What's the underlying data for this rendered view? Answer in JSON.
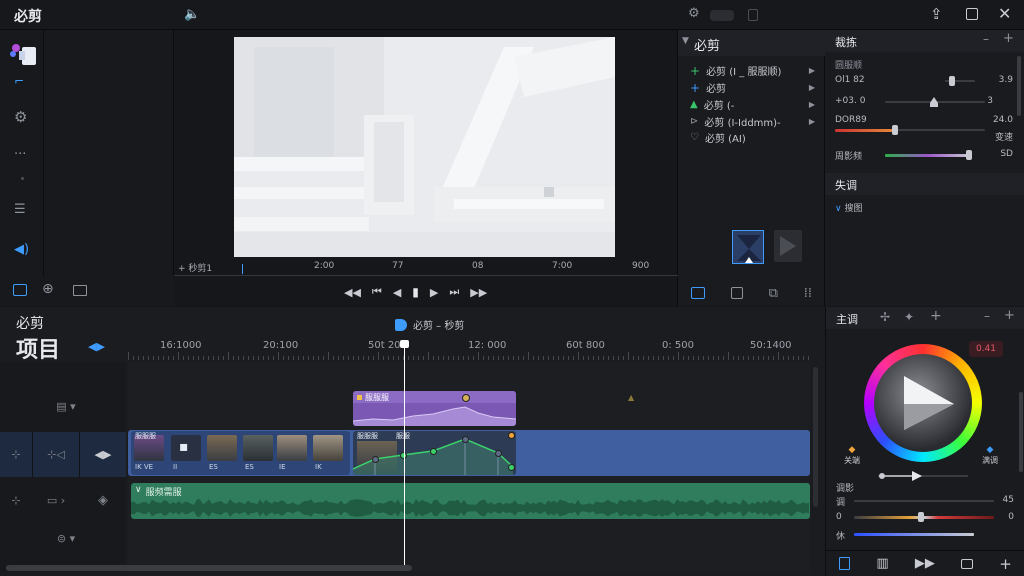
{
  "app": {
    "title": "必剪"
  },
  "titlebar": {
    "left_icon": "speaker-icon",
    "center_icons": [
      "settings-icon",
      "toggle-icon",
      "save-icon"
    ],
    "right_icons": [
      "upload-icon",
      "maximize-icon",
      "close-icon"
    ]
  },
  "left_toolbar": {
    "items": [
      "logo-icon",
      "crop-icon",
      "gear-icon",
      "more-icon",
      "list-icon",
      "volume-icon"
    ],
    "bottom": [
      "monitor-icon",
      "target-icon",
      "frame-icon"
    ]
  },
  "preview": {
    "timecodes": [
      "+ 秒剪1",
      "2:00",
      "77",
      "08",
      "7:00",
      "900"
    ],
    "controls": [
      "rewind-icon",
      "prev-icon",
      "step-back-icon",
      "play-pause-icon",
      "step-forward-icon",
      "next-icon",
      "fast-forward-icon"
    ]
  },
  "effects_panel": {
    "title": "必剪",
    "items": [
      {
        "label": "必剪 (I _ 服服顺)",
        "icon": "plus-icon"
      },
      {
        "label": "必剪",
        "icon": "plus-icon"
      },
      {
        "label": "必剪 (-",
        "icon": "triangle-icon"
      },
      {
        "label": "必剪 (I-Iddmm)-",
        "icon": "play-icon"
      },
      {
        "label": "必剪 (AI)",
        "icon": "heart-icon"
      }
    ]
  },
  "properties": {
    "title": "裁拣",
    "subtitle": "圆服顺",
    "rows": [
      {
        "label": "Ol1 82",
        "value": "3.9",
        "level": 0.55
      },
      {
        "label": "+03. 0",
        "value": "3",
        "level": 0.5
      },
      {
        "label": "DOR89",
        "value": "24.0",
        "level": 0.12
      },
      {
        "label": "",
        "value": "变速",
        "level": null
      },
      {
        "label": "周影频",
        "value": "SD",
        "level": 0.95
      }
    ],
    "section": "失调",
    "section_item": "搜图"
  },
  "timeline_header": {
    "title_top": "必剪",
    "title_main": "项目",
    "center_label": "必剪 – 秒剪",
    "ruler": [
      "16:1000",
      "20:100",
      "50t 20",
      "12: 000",
      "60t 800",
      "0: 500",
      "50:1400"
    ]
  },
  "tracks": {
    "overlay_clip_label": "服服服",
    "video_clip_label": "服服服",
    "video_clip2_label": "服服",
    "audio_clip_label": "服频需服",
    "thumbs": [
      "IK VE",
      "II",
      "ES",
      "ES",
      "IE",
      "IK"
    ]
  },
  "color_panel": {
    "title": "主调",
    "value_badge": "0.41",
    "left_label": "关端",
    "right_label": "满调",
    "section": "调影",
    "sliders": [
      {
        "label": "调",
        "value": "45",
        "level": 0.82
      },
      {
        "label": "0",
        "value": "0",
        "level": 0.5
      },
      {
        "label": "休",
        "value": "",
        "level": 0.9
      }
    ],
    "bottom_icons": [
      "doc-icon",
      "book-icon",
      "skip-icon",
      "screen-icon",
      "add-icon"
    ]
  },
  "colors": {
    "accent": "#3e9cff",
    "video_track": "#3f5fa0",
    "overlay_clip": "#7b58b3",
    "audio_track": "#2f7d5c",
    "playhead": "#ffffff"
  }
}
